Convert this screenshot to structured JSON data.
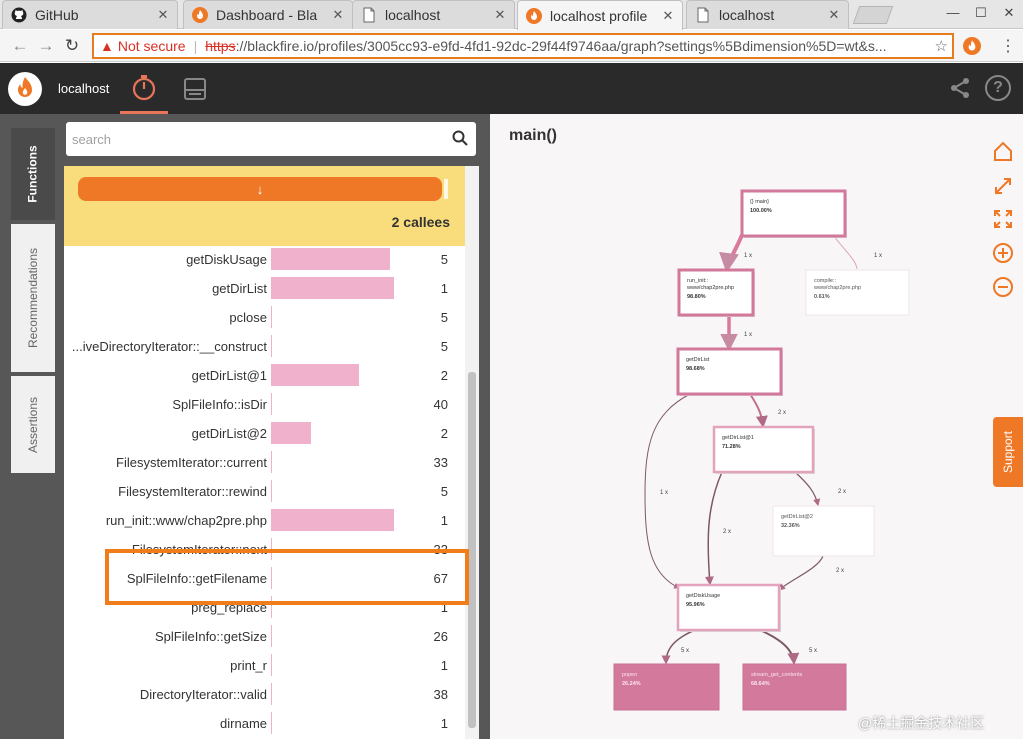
{
  "browser": {
    "tabs": [
      {
        "title": "GitHub",
        "icon": "github-icon",
        "active": false
      },
      {
        "title": "Dashboard - Bla",
        "icon": "blackfire-icon",
        "active": false
      },
      {
        "title": "localhost",
        "icon": "page-icon",
        "active": false
      },
      {
        "title": "localhost profile",
        "icon": "blackfire-icon",
        "active": true
      },
      {
        "title": "localhost",
        "icon": "page-icon",
        "active": false
      }
    ],
    "security_label": "Not secure",
    "url_scheme": "https",
    "url_rest": "://blackfire.io/profiles/3005cc93-e9fd-4fd1-92dc-29f44f9746aa/graph?settings%5Bdimension%5D=wt&s..."
  },
  "app": {
    "name": "localhost",
    "side_tabs": [
      "Functions",
      "Recommendations",
      "Assertions"
    ],
    "search_placeholder": "search",
    "arrow_glyph": "↓",
    "callees_label": "2 callees",
    "support_label": "Support"
  },
  "functions": [
    {
      "name": "getDiskUsage",
      "count": "5",
      "pct": 0.306
    },
    {
      "name": "getDirList",
      "count": "1",
      "pct": 0.316
    },
    {
      "name": "pclose",
      "count": "5",
      "pct": 0
    },
    {
      "name": "...iveDirectoryIterator::__construct",
      "count": "5",
      "pct": 0
    },
    {
      "name": "getDirList@1",
      "count": "2",
      "pct": 0.228
    },
    {
      "name": "SplFileInfo::isDir",
      "count": "40",
      "pct": 0
    },
    {
      "name": "getDirList@2",
      "count": "2",
      "pct": 0.104
    },
    {
      "name": "FilesystemIterator::current",
      "count": "33",
      "pct": 0
    },
    {
      "name": "FilesystemIterator::rewind",
      "count": "5",
      "pct": 0
    },
    {
      "name": "run_init::www/chap2pre.php",
      "count": "1",
      "pct": 0.316
    },
    {
      "name": "FilesystemIterator::next",
      "count": "33",
      "pct": 0
    },
    {
      "name": "SplFileInfo::getFilename",
      "count": "67",
      "pct": 0
    },
    {
      "name": "preg_replace",
      "count": "1",
      "pct": 0
    },
    {
      "name": "SplFileInfo::getSize",
      "count": "26",
      "pct": 0
    },
    {
      "name": "print_r",
      "count": "1",
      "pct": 0
    },
    {
      "name": "DirectoryIterator::valid",
      "count": "38",
      "pct": 0
    },
    {
      "name": "dirname",
      "count": "1",
      "pct": 0
    }
  ],
  "graph": {
    "title": "main()",
    "nodes": [
      {
        "label": "{} main}",
        "value": "100.00%",
        "style": "strong"
      },
      {
        "label": "run_init::\nwww/chap2pre.php",
        "value": "98.80%",
        "style": "strong"
      },
      {
        "label": "compile::\nwww/chap2pre.php",
        "value": "0.61%",
        "style": "light"
      },
      {
        "label": "getDirList",
        "value": "98.68%",
        "style": "strong"
      },
      {
        "label": "getDirList@1",
        "value": "71.28%",
        "style": "medium"
      },
      {
        "label": "getDirList@2",
        "value": "32.36%",
        "style": "light"
      },
      {
        "label": "getDiskUsage",
        "value": "95.96%",
        "style": "medium"
      },
      {
        "label": "popen",
        "value": "26.24%",
        "style": "filled"
      },
      {
        "label": "stream_get_contents",
        "value": "68.64%",
        "style": "filled"
      }
    ],
    "edge_labels": [
      "1 x",
      "1 x",
      "1 x",
      "2 x",
      "1 x",
      "2 x",
      "2 x",
      "2 x",
      "5 x",
      "5 x"
    ]
  },
  "watermark": "@稀土掘金技术社区",
  "colors": {
    "accent": "#ee7826",
    "bar": "#f0b1cc",
    "highlight": "#f07d1a",
    "node_border": "#d07890",
    "node_fill": "#d3799c"
  }
}
